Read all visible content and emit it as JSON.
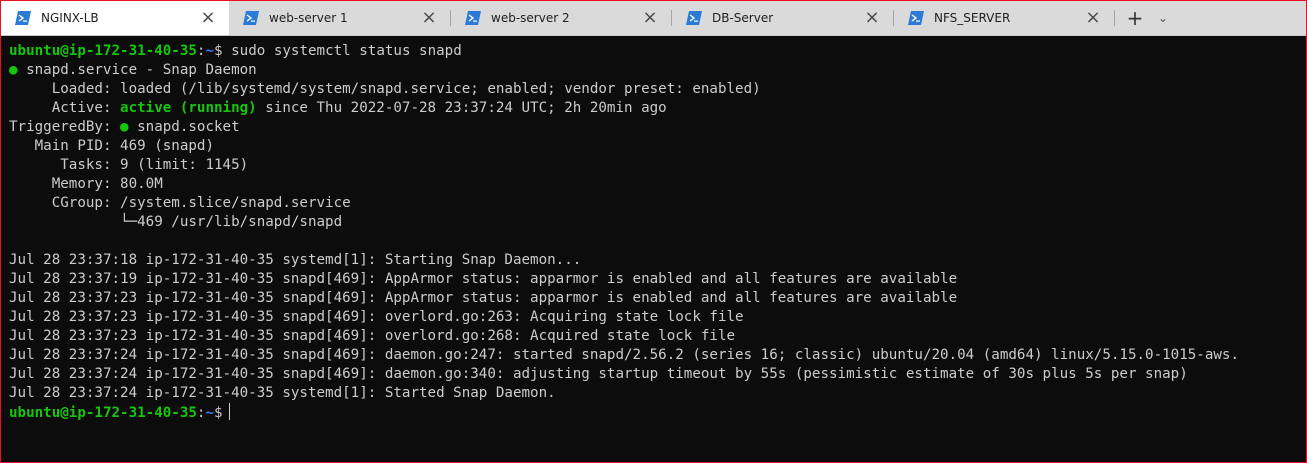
{
  "tabs": [
    {
      "title": "NGINX-LB",
      "active": true
    },
    {
      "title": "web-server 1",
      "active": false
    },
    {
      "title": "web-server 2",
      "active": false
    },
    {
      "title": "DB-Server",
      "active": false
    },
    {
      "title": "NFS_SERVER",
      "active": false
    }
  ],
  "tab_close_glyph": "×",
  "new_tab_glyph": "+",
  "dropdown_glyph": "⌄",
  "colors": {
    "accent_border": "#e81123",
    "prompt_user": "#16c60c",
    "prompt_path": "#3b78ff",
    "status_ok": "#16c60c",
    "terminal_bg": "#0c0c0c",
    "terminal_fg": "#cccccc"
  },
  "prompt": {
    "user_host": "ubuntu@ip-172-31-40-35",
    "colon": ":",
    "path": "~",
    "dollar": "$"
  },
  "command": "sudo systemctl status snapd",
  "status": {
    "bullet": "●",
    "unit_line": " snapd.service - Snap Daemon",
    "loaded_label": "     Loaded: ",
    "loaded_value": "loaded (/lib/systemd/system/snapd.service; enabled; vendor preset: enabled)",
    "active_label": "     Active: ",
    "active_value": "active (running)",
    "active_since": " since Thu 2022-07-28 23:37:24 UTC; 2h 20min ago",
    "triggered_label": "TriggeredBy: ",
    "triggered_value": " snapd.socket",
    "mainpid_line": "   Main PID: 469 (snapd)",
    "tasks_line": "      Tasks: 9 (limit: 1145)",
    "memory_line": "     Memory: 80.0M",
    "cgroup_line": "     CGroup: /system.slice/snapd.service",
    "cgroup_child": "             └─469 /usr/lib/snapd/snapd"
  },
  "log_lines": [
    "Jul 28 23:37:18 ip-172-31-40-35 systemd[1]: Starting Snap Daemon...",
    "Jul 28 23:37:19 ip-172-31-40-35 snapd[469]: AppArmor status: apparmor is enabled and all features are available",
    "Jul 28 23:37:23 ip-172-31-40-35 snapd[469]: AppArmor status: apparmor is enabled and all features are available",
    "Jul 28 23:37:23 ip-172-31-40-35 snapd[469]: overlord.go:263: Acquiring state lock file",
    "Jul 28 23:37:23 ip-172-31-40-35 snapd[469]: overlord.go:268: Acquired state lock file",
    "Jul 28 23:37:24 ip-172-31-40-35 snapd[469]: daemon.go:247: started snapd/2.56.2 (series 16; classic) ubuntu/20.04 (amd64) linux/5.15.0-1015-aws.",
    "Jul 28 23:37:24 ip-172-31-40-35 snapd[469]: daemon.go:340: adjusting startup timeout by 55s (pessimistic estimate of 30s plus 5s per snap)",
    "Jul 28 23:37:24 ip-172-31-40-35 systemd[1]: Started Snap Daemon."
  ]
}
